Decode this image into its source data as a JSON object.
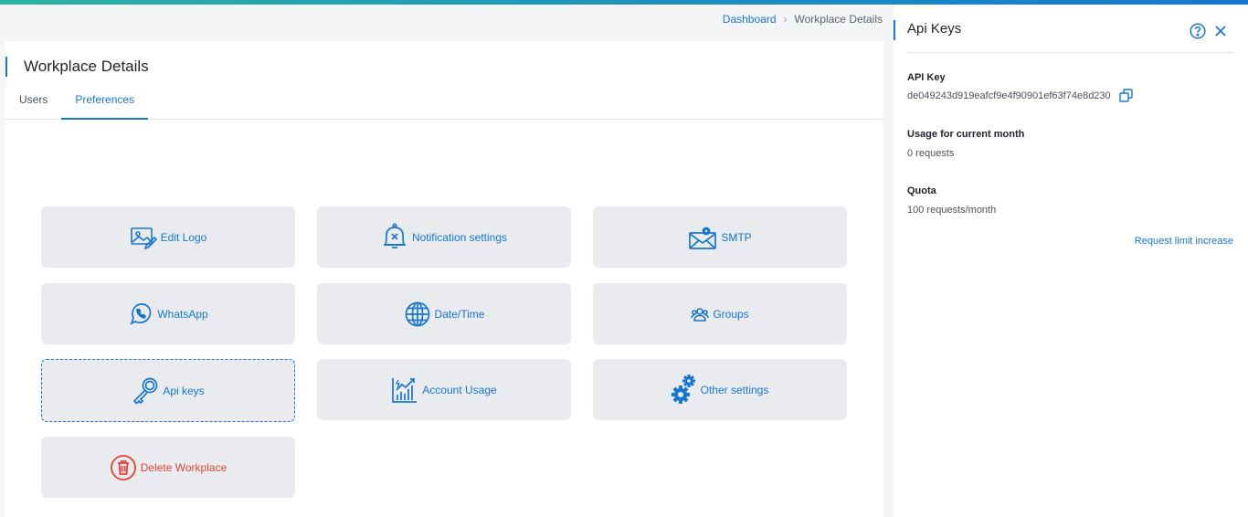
{
  "breadcrumb": {
    "home": "Dashboard",
    "current": "Workplace Details"
  },
  "page": {
    "title": "Workplace Details"
  },
  "tabs": [
    {
      "label": "Users",
      "active": false
    },
    {
      "label": "Preferences",
      "active": true
    }
  ],
  "cards": {
    "edit_logo": {
      "label": "Edit Logo",
      "icon": "image-edit-icon"
    },
    "notification": {
      "label": "Notification settings",
      "icon": "bell-icon"
    },
    "smtp": {
      "label": "SMTP",
      "icon": "envelope-gear-icon"
    },
    "whatsapp": {
      "label": "WhatsApp",
      "icon": "whatsapp-icon"
    },
    "datetime": {
      "label": "Date/Time",
      "icon": "globe-icon"
    },
    "groups": {
      "label": "Groups",
      "icon": "users-icon"
    },
    "api_keys": {
      "label": "Api keys",
      "icon": "key-icon",
      "selected": true
    },
    "account_usage": {
      "label": "Account Usage",
      "icon": "chart-icon"
    },
    "other_settings": {
      "label": "Other settings",
      "icon": "gears-icon"
    },
    "delete_workplace": {
      "label": "Delete Workplace",
      "icon": "trash-icon"
    }
  },
  "panel": {
    "title": "Api Keys",
    "api_key_label": "API Key",
    "api_key_value": "de049243d919eafcf9e4f90901ef63f74e8d230",
    "usage_label": "Usage for current month",
    "usage_value": "0 requests",
    "quota_label": "Quota",
    "quota_value": "100 requests/month",
    "request_link": "Request limit increase"
  },
  "colors": {
    "accent": "#1677cf",
    "danger": "#e0443a",
    "card_bg": "#e9ebef"
  }
}
